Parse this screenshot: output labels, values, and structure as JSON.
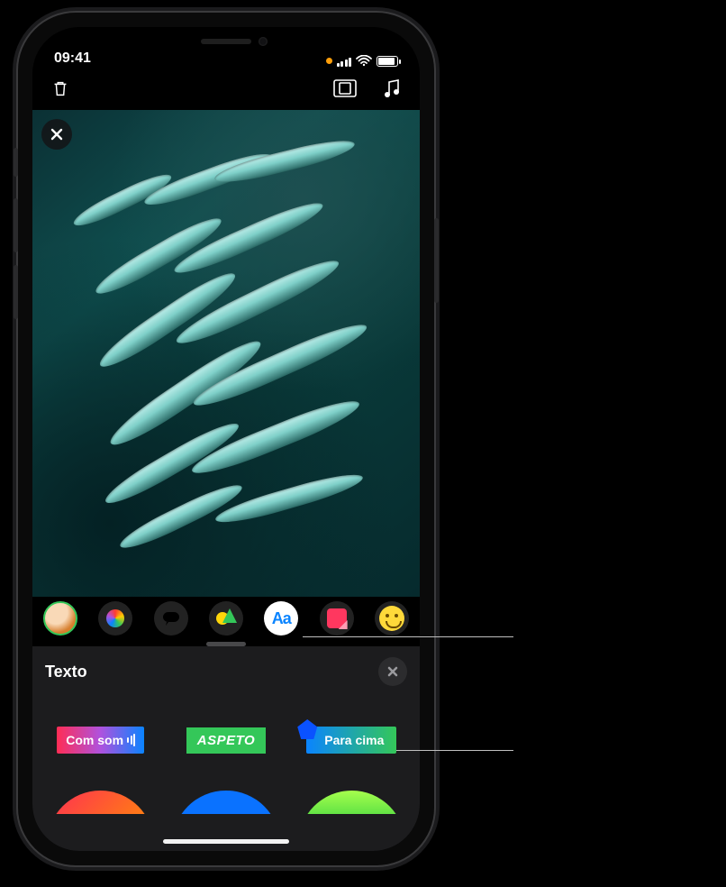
{
  "status": {
    "time": "09:41"
  },
  "toolbar": {
    "trash_name": "trash-icon",
    "layout_name": "aspect-icon",
    "music_name": "music-icon"
  },
  "viewer": {
    "close_name": "close-icon"
  },
  "fx": {
    "items": [
      {
        "name": "memoji-button"
      },
      {
        "name": "filters-button"
      },
      {
        "name": "text-effects-button"
      },
      {
        "name": "shapes-button"
      },
      {
        "name": "text-button",
        "label": "Aa",
        "selected": true
      },
      {
        "name": "stickers-button"
      },
      {
        "name": "emoji-button"
      }
    ]
  },
  "panel": {
    "title": "Texto",
    "close_name": "close-icon",
    "styles": [
      {
        "name": "text-style-com-som",
        "label": "Com som"
      },
      {
        "name": "text-style-aspeto",
        "label": "ASPETO"
      },
      {
        "name": "text-style-para-cima",
        "label": "Para cima"
      }
    ]
  }
}
